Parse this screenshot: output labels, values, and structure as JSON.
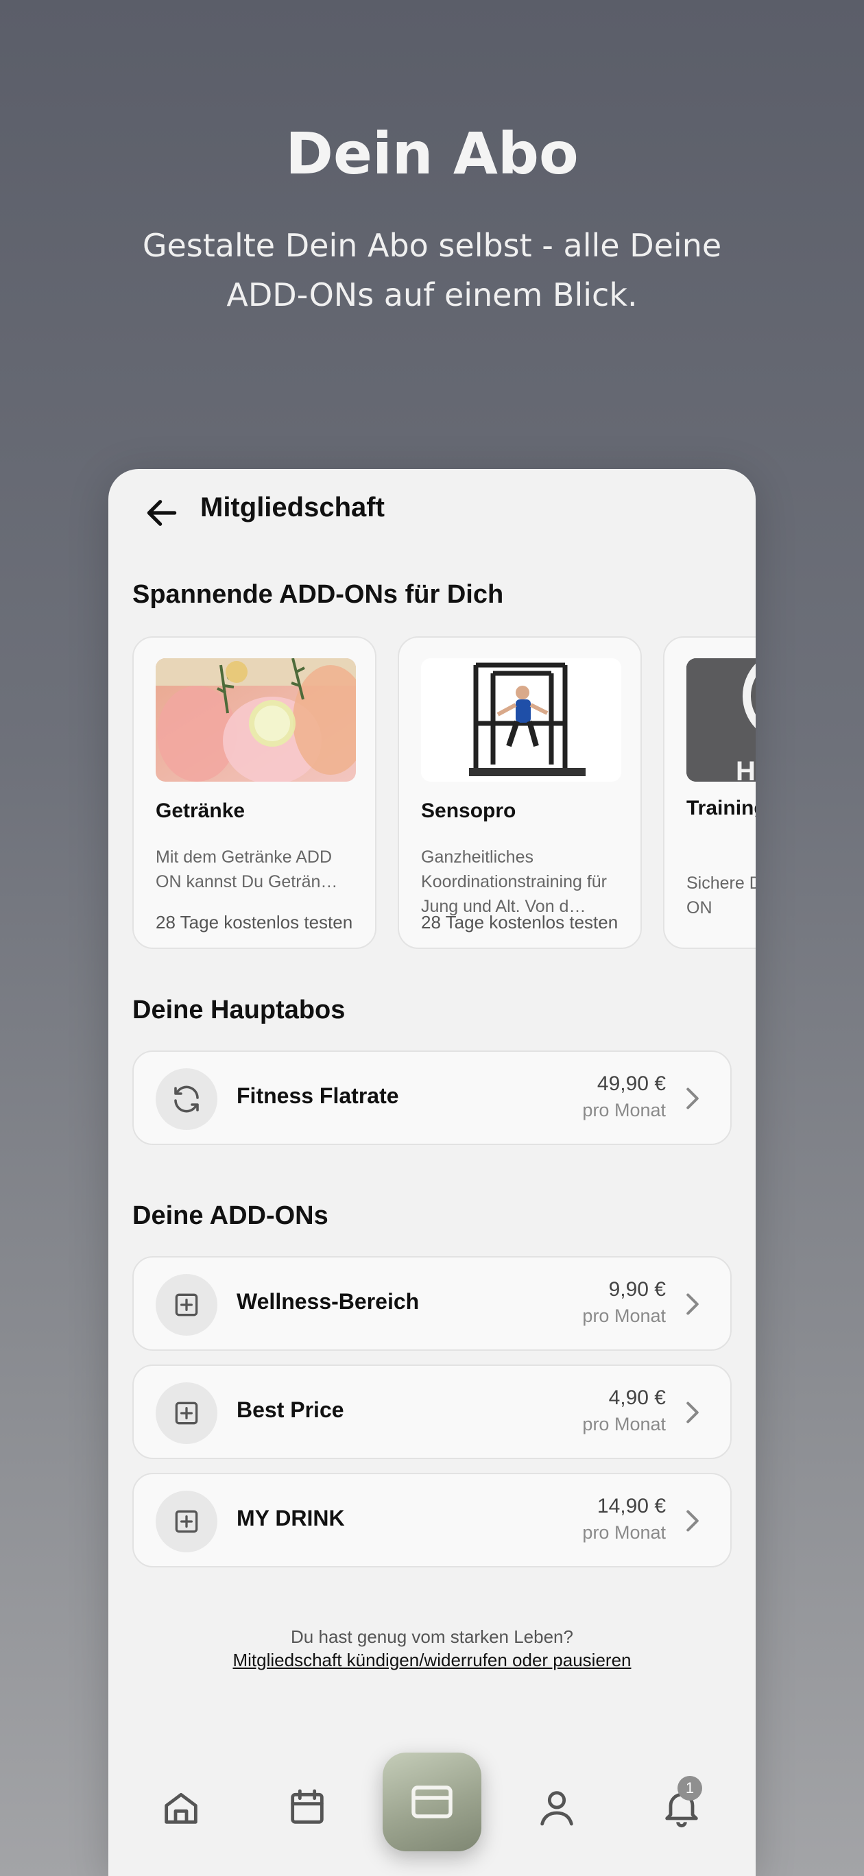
{
  "hero": {
    "title": "Dein Abo",
    "subtitle": "Gestalte Dein Abo selbst - alle Deine ADD-ONs auf einem Blick."
  },
  "topbar": {
    "title": "Mitgliedschaft"
  },
  "addons_section": {
    "title": "Spannende ADD-ONs für Dich",
    "cards": [
      {
        "name": "Getränke",
        "description": "Mit dem Getränke ADD ON kannst Du Geträn…",
        "trial": "28 Tage kostenlos testen"
      },
      {
        "name": "Sensopro",
        "description": "Ganzheitliches Koordinationstraining für Jung und Alt. Von d…",
        "trial": "28 Tage kostenlos testen"
      },
      {
        "name": "Training ADD-O",
        "description": "Sichere D Trainings ADD-ON",
        "image_text": "H"
      }
    ]
  },
  "main_subs": {
    "title": "Deine Hauptabos",
    "items": [
      {
        "name": "Fitness Flatrate",
        "price": "49,90 €",
        "period": "pro Monat",
        "icon": "refresh-icon"
      }
    ]
  },
  "my_addons": {
    "title": "Deine ADD-ONs",
    "items": [
      {
        "name": "Wellness-Bereich",
        "price": "9,90 €",
        "period": "pro Monat",
        "icon": "plus-square-icon"
      },
      {
        "name": "Best Price",
        "price": "4,90 €",
        "period": "pro Monat",
        "icon": "plus-square-icon"
      },
      {
        "name": "MY DRINK",
        "price": "14,90 €",
        "period": "pro Monat",
        "icon": "plus-square-icon"
      }
    ]
  },
  "footer": {
    "question": "Du hast genug vom starken Leben?",
    "link": "Mitgliedschaft kündigen/widerrufen oder pausieren"
  },
  "bottom_nav": {
    "items": [
      "home-icon",
      "calendar-icon",
      "card-icon",
      "profile-icon",
      "bell-icon"
    ],
    "notification_count": "1"
  },
  "colors": {
    "accent": "#9ca48f",
    "background": "#f2f2f2"
  }
}
